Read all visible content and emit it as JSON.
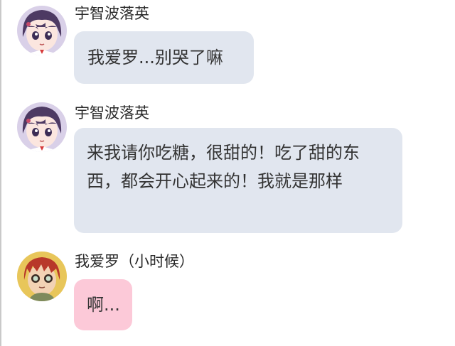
{
  "messages": [
    {
      "sender": "宇智波落英",
      "text": "我爱罗...别哭了嘛",
      "avatar_icon": "anime-girl-purple-hair-icon",
      "bubble_color": "#e1e6ef"
    },
    {
      "sender": "宇智波落英",
      "text": "来我请你吃糖，很甜的！吃了甜的东西，都会开心起来的！我就是那样",
      "avatar_icon": "anime-girl-purple-hair-icon",
      "bubble_color": "#e1e6ef"
    },
    {
      "sender": "我爱罗（小时候）",
      "text": "啊...",
      "avatar_icon": "gaara-child-red-hair-icon",
      "bubble_color": "#fcc9d8"
    }
  ]
}
